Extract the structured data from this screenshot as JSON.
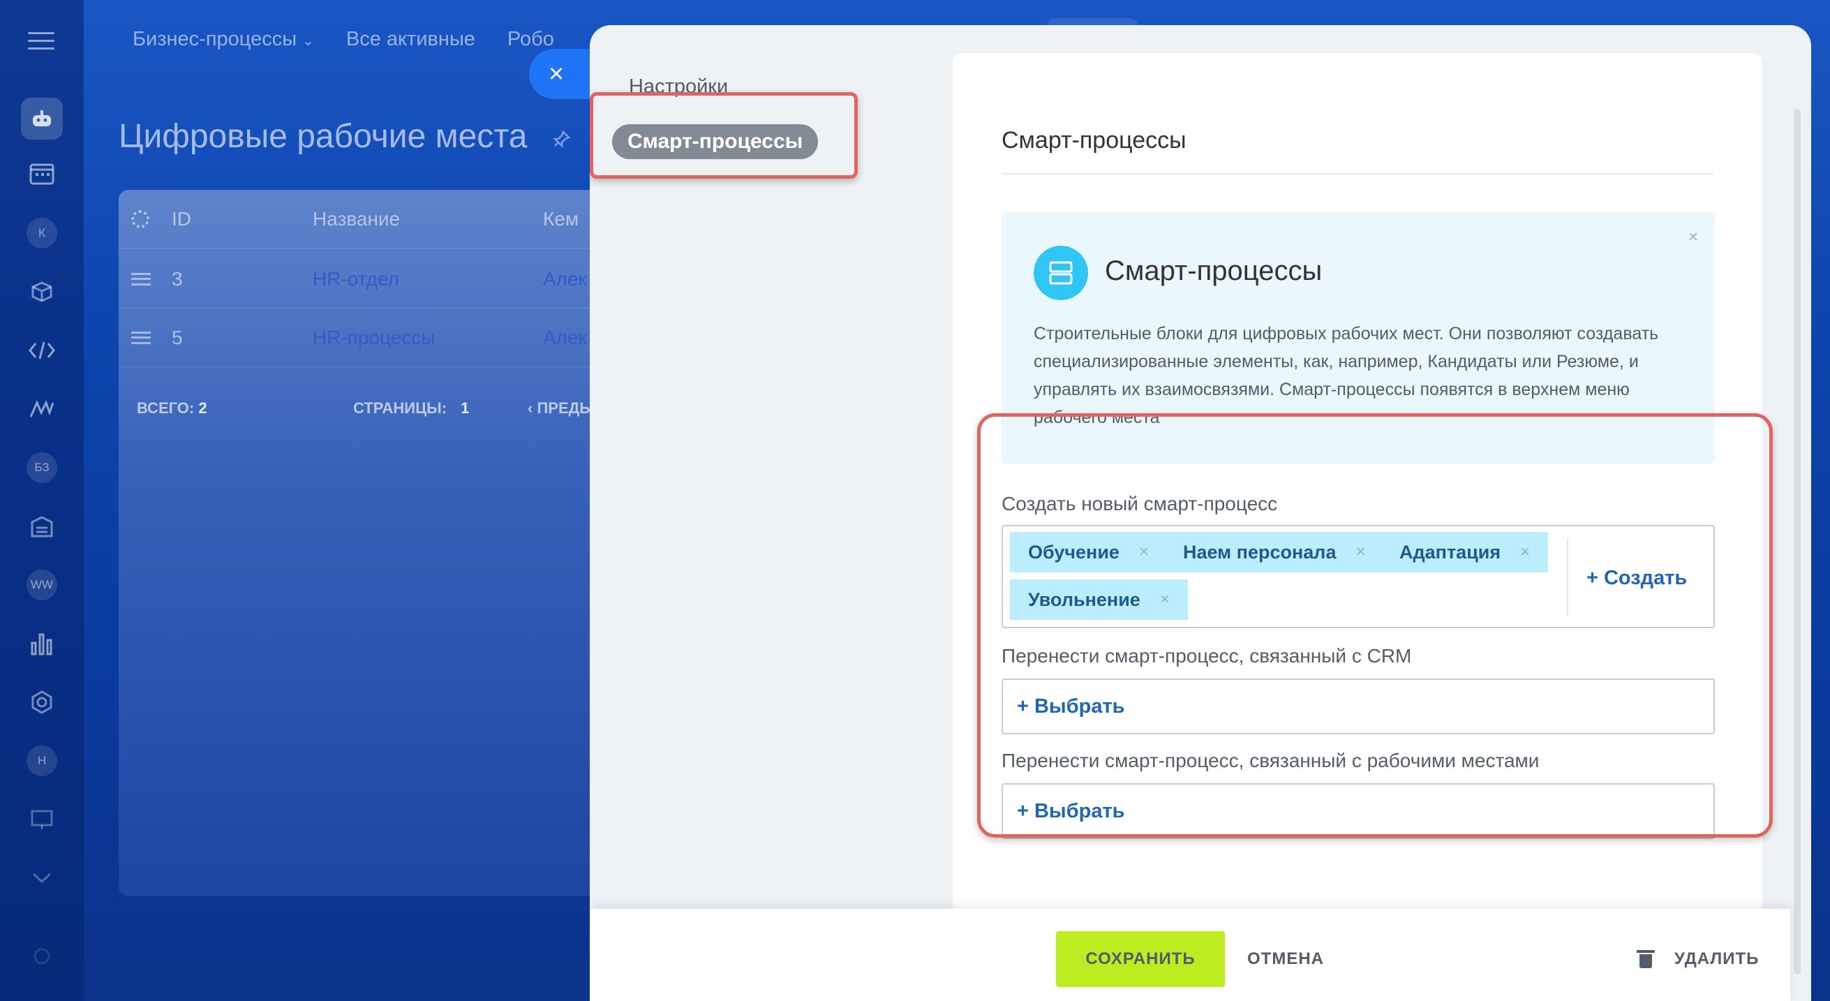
{
  "background": {
    "top_menu": [
      "Бизнес-процессы",
      "Все активные",
      "Робо"
    ],
    "page_title": "Цифровые рабочие места",
    "rail_badges": [
      "К",
      "БЗ",
      "WW",
      "Н"
    ],
    "table": {
      "headers": [
        "ID",
        "Название",
        "Кем"
      ],
      "rows": [
        {
          "id": "3",
          "name": "HR-отдел",
          "by": "Алек"
        },
        {
          "id": "5",
          "name": "HR-процессы",
          "by": "Алек"
        }
      ],
      "total_label": "ВСЕГО: ",
      "total_value": "2",
      "pages_label": "СТРАНИЦЫ: ",
      "pages_value": "1",
      "prev_label": "ПРЕДЫ"
    }
  },
  "slider": {
    "side_menu": {
      "title": "Настройки",
      "active_item": "Смарт-процессы"
    },
    "card": {
      "title": "Смарт-процессы",
      "info": {
        "heading": "Смарт-процессы",
        "text": "Строительные блоки для цифровых рабочих мест. Они позволяют создавать специализированные элементы, как, например, Кандидаты или Резюме, и управлять их взаимосвязями. Смарт-процессы появятся в верхнем меню рабочего места",
        "close": "×"
      },
      "create_section": {
        "label": "Создать новый смарт-процесс",
        "tags": [
          "Обучение",
          "Наем персонала",
          "Адаптация",
          "Увольнение"
        ],
        "tag_remove": "×",
        "create_button": "+ Создать"
      },
      "transfer_crm": {
        "label": "Перенести смарт-процесс, связанный с CRM",
        "select_button": "+ Выбрать"
      },
      "transfer_workspaces": {
        "label": "Перенести смарт-процесс, связанный с рабочими местами",
        "select_button": "+ Выбрать"
      }
    },
    "footer": {
      "save": "СОХРАНИТЬ",
      "cancel": "ОТМЕНА",
      "delete": "УДАЛИТЬ"
    },
    "close_symbol": "×"
  },
  "colors": {
    "accent_blue": "#1f74f5",
    "save_green": "#bbed21",
    "tag_bg": "#bcedfc",
    "highlight_red": "#e0645f",
    "info_icon": "#2fc6f6"
  }
}
